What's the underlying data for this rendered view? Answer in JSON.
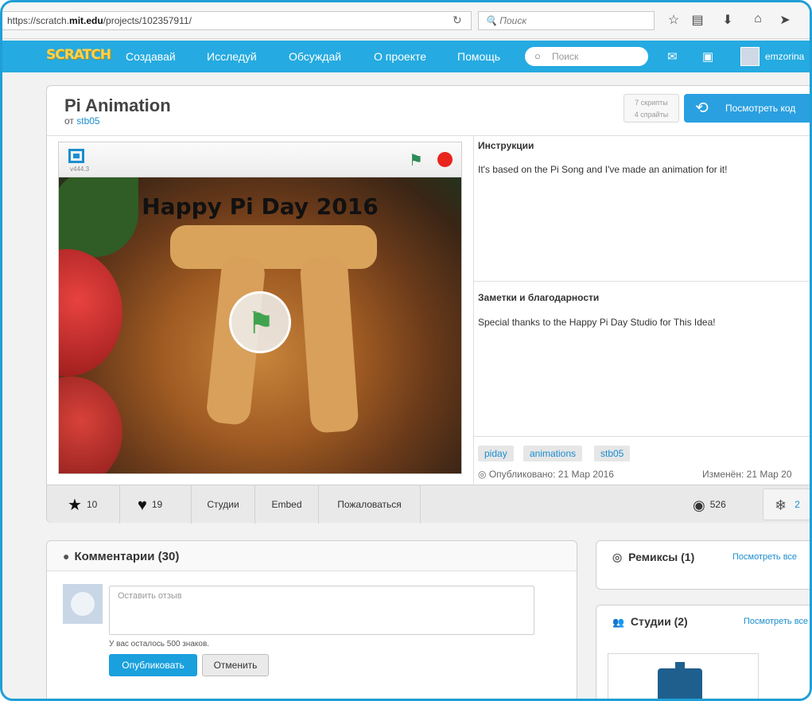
{
  "browser": {
    "url_prefix": "https://scratch.",
    "url_domain": "mit.edu",
    "url_path": "/projects/102357911/",
    "search_placeholder": "Поиск"
  },
  "nav": {
    "logo": "SCRATCH",
    "items": [
      "Создавай",
      "Исследуй",
      "Обсуждай",
      "О проекте",
      "Помощь"
    ],
    "search_placeholder": "Поиск",
    "username": "emzorina"
  },
  "project": {
    "title": "Pi Animation",
    "by_label": "от",
    "author": "stb05",
    "scripts_count": "7 скрипты",
    "sprites_count": "4 спрайты",
    "see_code_label": "Посмотреть код",
    "version": "v444.3",
    "stage_title": "Happy Pi Day 2016"
  },
  "instructions": {
    "title": "Инструкции",
    "text": "It's based on the Pi Song and I've made an animation for it!"
  },
  "notes": {
    "title": "Заметки и благодарности",
    "text": "Special thanks to the Happy Pi Day Studio for This Idea!"
  },
  "tags": [
    "piday",
    "animations",
    "stb05"
  ],
  "dates": {
    "published": "Опубликовано: 21 Мар 2016",
    "modified": "Изменён: 21 Мар 20"
  },
  "stats": {
    "favorites": "10",
    "loves": "19",
    "studios_label": "Студии",
    "embed_label": "Embed",
    "report_label": "Пожаловаться",
    "views": "526",
    "remixes": "2"
  },
  "comments": {
    "title": "Комментарии (30)",
    "placeholder": "Оставить отзыв",
    "chars_left": "У вас осталось 500 знаков.",
    "post_label": "Опубликовать",
    "cancel_label": "Отменить"
  },
  "remixes": {
    "title": "Ремиксы (1)",
    "see_all": "Посмотреть все"
  },
  "studios": {
    "title": "Студии (2)",
    "see_all": "Посмотреть все"
  }
}
